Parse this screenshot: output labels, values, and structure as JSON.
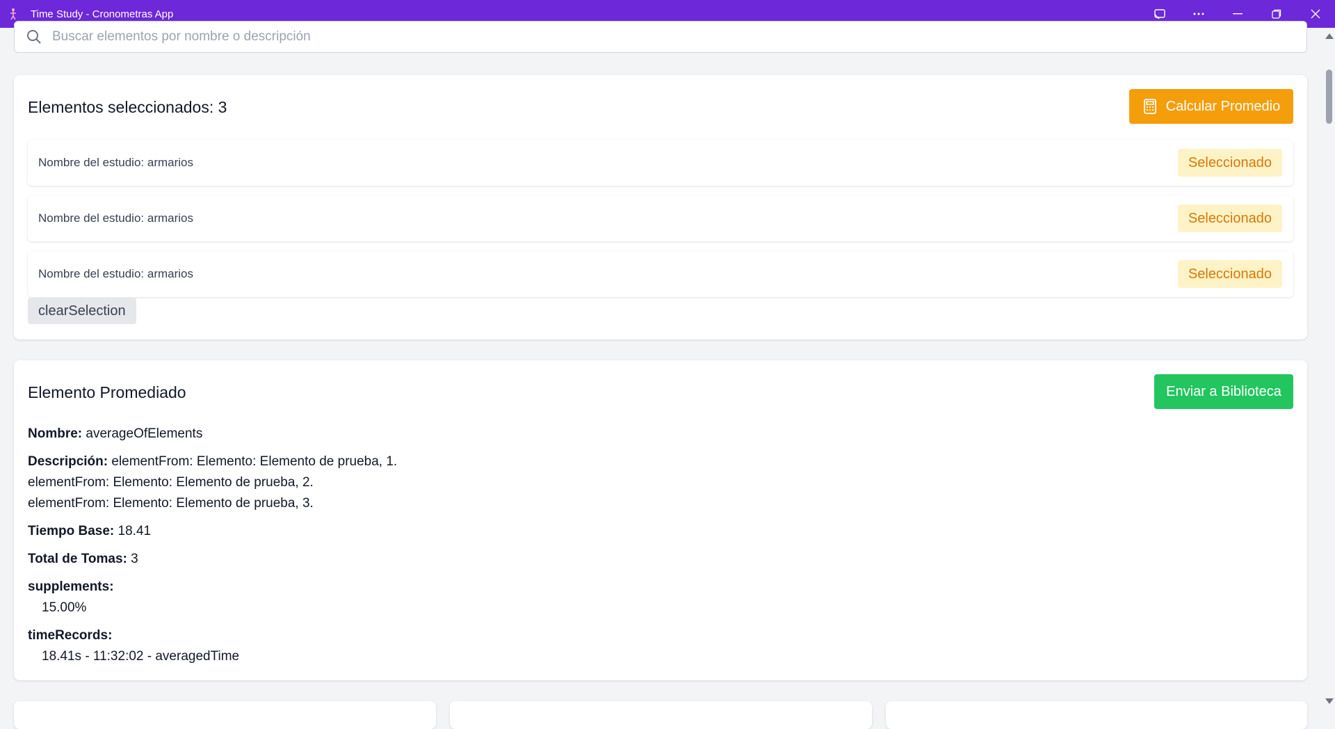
{
  "window": {
    "title": "Time Study - Cronometras App"
  },
  "search": {
    "placeholder": "Buscar elementos por nombre o descripción"
  },
  "selection": {
    "title": "Elementos seleccionados: 3",
    "calculate_label": "Calcular Promedio",
    "items": [
      {
        "label": "Nombre del estudio: armarios",
        "badge": "Seleccionado"
      },
      {
        "label": "Nombre del estudio: armarios",
        "badge": "Seleccionado"
      },
      {
        "label": "Nombre del estudio: armarios",
        "badge": "Seleccionado"
      }
    ],
    "clear_label": "clearSelection"
  },
  "averaged": {
    "title": "Elemento Promediado",
    "send_label": "Enviar a Biblioteca",
    "name_label": "Nombre:",
    "name_value": "averageOfElements",
    "description_label": "Descripción:",
    "description_lines": [
      "elementFrom: Elemento: Elemento de prueba, 1.",
      "elementFrom: Elemento: Elemento de prueba, 2.",
      "elementFrom: Elemento: Elemento de prueba, 3."
    ],
    "base_time_label": "Tiempo Base:",
    "base_time_value": "18.41",
    "total_label": "Total de Tomas:",
    "total_value": "3",
    "supplements_label": "supplements:",
    "supplements_value": "15.00%",
    "time_records_label": "timeRecords:",
    "time_records_value": "18.41s - 11:32:02 - averagedTime"
  },
  "colors": {
    "titlebar": "#6d28d9",
    "calculate_button": "#f59e0b",
    "send_button": "#22c55e",
    "badge_bg": "#fef3c7",
    "badge_text": "#d97706"
  },
  "icons": {
    "app": "stopwatch-figure-icon",
    "search": "search-icon",
    "calculate": "calculator-icon"
  }
}
